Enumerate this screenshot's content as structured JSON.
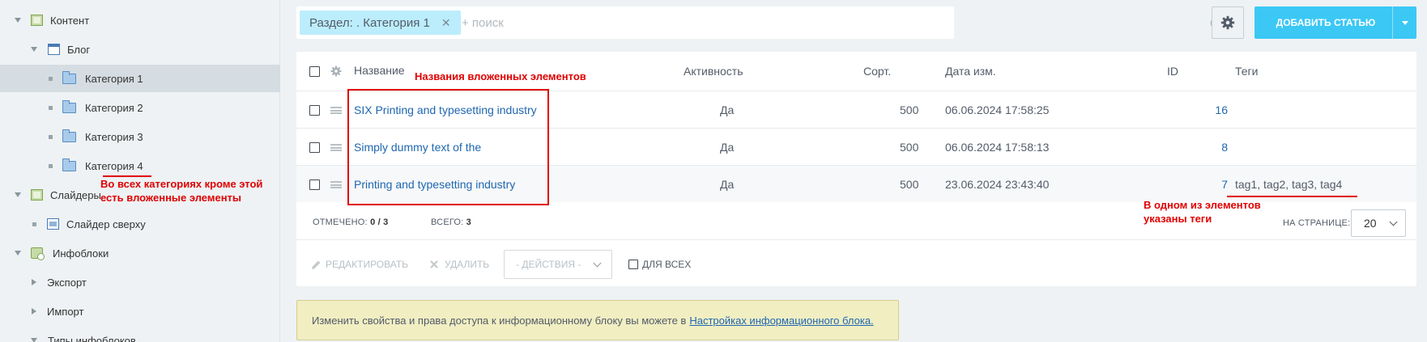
{
  "sidebar": {
    "items": [
      {
        "label": "Контент",
        "icon": "content-icon",
        "expander": "expanded"
      },
      {
        "label": "Блог",
        "icon": "list-icon",
        "expander": "expanded"
      },
      {
        "label": "Категория 1",
        "icon": "folder-icon",
        "selected": true
      },
      {
        "label": "Категория 2",
        "icon": "folder-icon"
      },
      {
        "label": "Категория 3",
        "icon": "folder-icon"
      },
      {
        "label": "Категория 4",
        "icon": "folder-icon"
      },
      {
        "label": "Слайдеры",
        "icon": "content-icon",
        "expander": "expanded"
      },
      {
        "label": "Слайдер сверху",
        "icon": "slider-icon"
      },
      {
        "label": "Инфоблоки",
        "icon": "iblock-icon",
        "expander": "expanded"
      },
      {
        "label": "Экспорт",
        "expander": "collapsed"
      },
      {
        "label": "Импорт",
        "expander": "collapsed"
      },
      {
        "label": "Типы инфоблоков",
        "expander": "expanded"
      }
    ]
  },
  "filter": {
    "chip_label": "Раздел: . Категория 1",
    "search_placeholder": "+ поиск"
  },
  "toolbar": {
    "add_button_label": "ДОБАВИТЬ СТАТЬЮ"
  },
  "grid": {
    "columns": [
      "Название",
      "Активность",
      "Сорт.",
      "Дата изм.",
      "ID",
      "Теги"
    ],
    "rows": [
      {
        "name": "SIX Printing and typesetting industry",
        "active": "Да",
        "sort": "500",
        "date": "06.06.2024 17:58:25",
        "id": "16",
        "tags": ""
      },
      {
        "name": "Simply dummy text of the",
        "active": "Да",
        "sort": "500",
        "date": "06.06.2024 17:58:13",
        "id": "8",
        "tags": ""
      },
      {
        "name": "Printing and typesetting industry",
        "active": "Да",
        "sort": "500",
        "date": "23.06.2024 23:43:40",
        "id": "7",
        "tags": "tag1, tag2, tag3, tag4"
      }
    ],
    "selected_label": "ОТМЕЧЕНО:",
    "selected_value": "0 / 3",
    "total_label": "ВСЕГО:",
    "total_value": "3",
    "per_page_label": "НА СТРАНИЦЕ:",
    "per_page_value": "20",
    "actions": {
      "edit": "РЕДАКТИРОВАТЬ",
      "delete": "УДАЛИТЬ",
      "select": "- ДЕЙСТВИЯ -",
      "for_all": "ДЛЯ ВСЕХ"
    }
  },
  "annotations": {
    "names_note": "Названия вложенных элементов",
    "categories_note_1": "Во всех категориях кроме этой",
    "categories_note_2": "есть вложенные элементы",
    "tags_note_1": "В одном из элементов",
    "tags_note_2": "указаны теги"
  },
  "info": {
    "text": "Изменить свойства и права доступа к информационному блоку вы можете в",
    "link": "Настройках информационного блока."
  },
  "colors": {
    "accent": "#3bc8f5",
    "link": "#2067b0",
    "chip": "#bcedfc",
    "annotation": "#e00000",
    "info_bg": "#f1eec2"
  }
}
